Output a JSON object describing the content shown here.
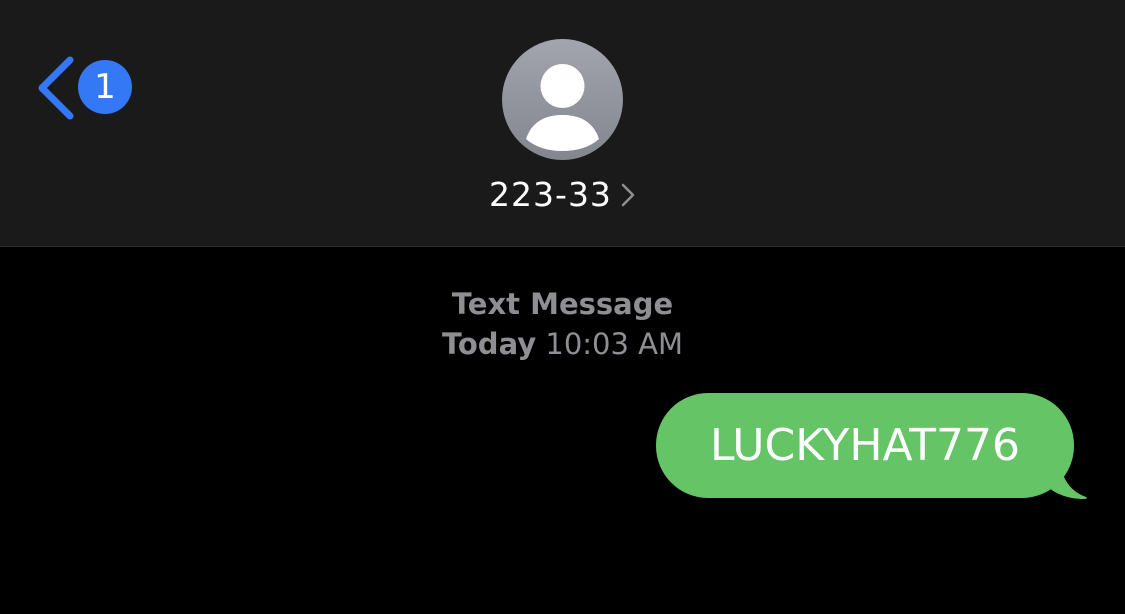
{
  "nav": {
    "unread_count": "1"
  },
  "contact": {
    "name": "223-33"
  },
  "conversation": {
    "service_label": "Text Message",
    "day": "Today",
    "time": "10:03 AM",
    "messages": [
      {
        "direction": "outgoing",
        "text": "LUCKYHAT776"
      }
    ]
  },
  "colors": {
    "header_bg": "#1a1a1a",
    "background": "#000000",
    "accent_blue": "#3478f6",
    "bubble_green": "#65c466",
    "meta_gray": "#8e8e93"
  },
  "icons": {
    "back": "chevron-left-icon",
    "contact_detail": "chevron-right-icon",
    "avatar": "person-silhouette-icon"
  }
}
